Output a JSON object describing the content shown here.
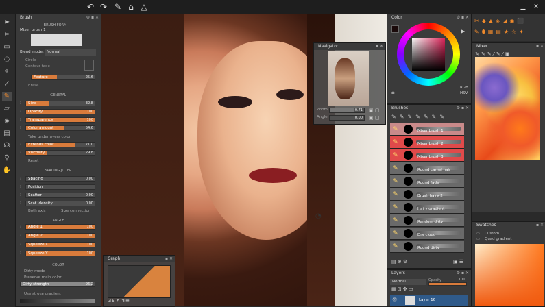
{
  "brush_panel": {
    "title": "Brush",
    "brush_form_header": "BRUSH FORM",
    "brush_name": "Mixer brush 1",
    "blend_mode_label": "Blend mode:",
    "blend_mode_value": "Normal",
    "circle_label": "Circle",
    "contour_fade_label": "Contour fade",
    "feature_label": "Feature",
    "feature_value": "25.6",
    "erase_label": "Erase",
    "general_header": "GENERAL",
    "sliders_general": [
      {
        "label": "Size",
        "value": "32.8",
        "fill": 0.33
      },
      {
        "label": "Opacity",
        "value": "100",
        "fill": 1.0
      },
      {
        "label": "Transparency",
        "value": "100",
        "fill": 1.0
      },
      {
        "label": "Color amount",
        "value": "54.6",
        "fill": 0.55
      }
    ],
    "take_underlayers": "Take underlayers color",
    "sliders_general2": [
      {
        "label": "Extends color",
        "value": "71.0",
        "fill": 0.71
      },
      {
        "label": "Viscosity",
        "value": "29.8",
        "fill": 0.3
      }
    ],
    "reset_label": "Reset",
    "spacing_header": "SPACING JITTER",
    "sliders_spacing": [
      {
        "label": "Spacing",
        "value": "0.00",
        "fill": 0.0
      },
      {
        "label": "Position",
        "value": "",
        "fill": 0.0
      },
      {
        "label": "Scatter",
        "value": "0.00",
        "fill": 0.0
      },
      {
        "label": "Scat. density",
        "value": "0.00",
        "fill": 0.0
      }
    ],
    "both_axis": "Both axis",
    "size_connection": "Size connection",
    "angle_header": "ANGLE",
    "sliders_angle": [
      {
        "label": "Angle 1",
        "value": "100",
        "fill": 1.0
      },
      {
        "label": "Angle 2",
        "value": "100",
        "fill": 1.0
      },
      {
        "label": "Squeeze X",
        "value": "100",
        "fill": 1.0
      },
      {
        "label": "Squeeze Y",
        "value": "100",
        "fill": 1.0
      }
    ],
    "color_header": "COLOR",
    "dirty_mode": "Dirty mode",
    "preserve_main_color": "Preserve main color",
    "dirty_strength_label": "Dirty strength",
    "dirty_strength_value": "96.2",
    "use_stroke_gradient": "Use stroke gradient"
  },
  "navigator": {
    "title": "Navigator",
    "zoom_label": "Zoom",
    "zoom_value": "0.71",
    "angle_label": "Angle",
    "angle_value": "0.00"
  },
  "graph": {
    "title": "Graph"
  },
  "color_panel": {
    "title": "Color",
    "rgb_label": "RGB",
    "hsv_label": "HSV"
  },
  "brushes_panel": {
    "title": "Brushes",
    "items": [
      {
        "name": "Mixer brush 1",
        "style": "pink"
      },
      {
        "name": "Mixer brush 2",
        "style": "red"
      },
      {
        "name": "Mixer brush 3",
        "style": "red"
      },
      {
        "name": "Round camel hair",
        "style": "gray"
      },
      {
        "name": "Round fade",
        "style": "gray"
      },
      {
        "name": "Brush hairy 2",
        "style": "gray"
      },
      {
        "name": "Hairy gradient",
        "style": "gray"
      },
      {
        "name": "Random dirty",
        "style": "gray"
      },
      {
        "name": "Dry cloud",
        "style": "gray"
      },
      {
        "name": "Round dirty",
        "style": "gray"
      }
    ]
  },
  "layers_panel": {
    "title": "Layers",
    "blend_value": "Normal",
    "opacity_label": "Opacity",
    "opacity_value": "100",
    "layer_name": "Layer 16"
  },
  "mixer_panel": {
    "title": "Mixer"
  },
  "swatches_panel": {
    "title": "Swatches",
    "items": [
      "Custom",
      "Quad gradient"
    ]
  },
  "colors": {
    "accent": "#d97b3b",
    "brush_selected": "#e04a4a"
  }
}
